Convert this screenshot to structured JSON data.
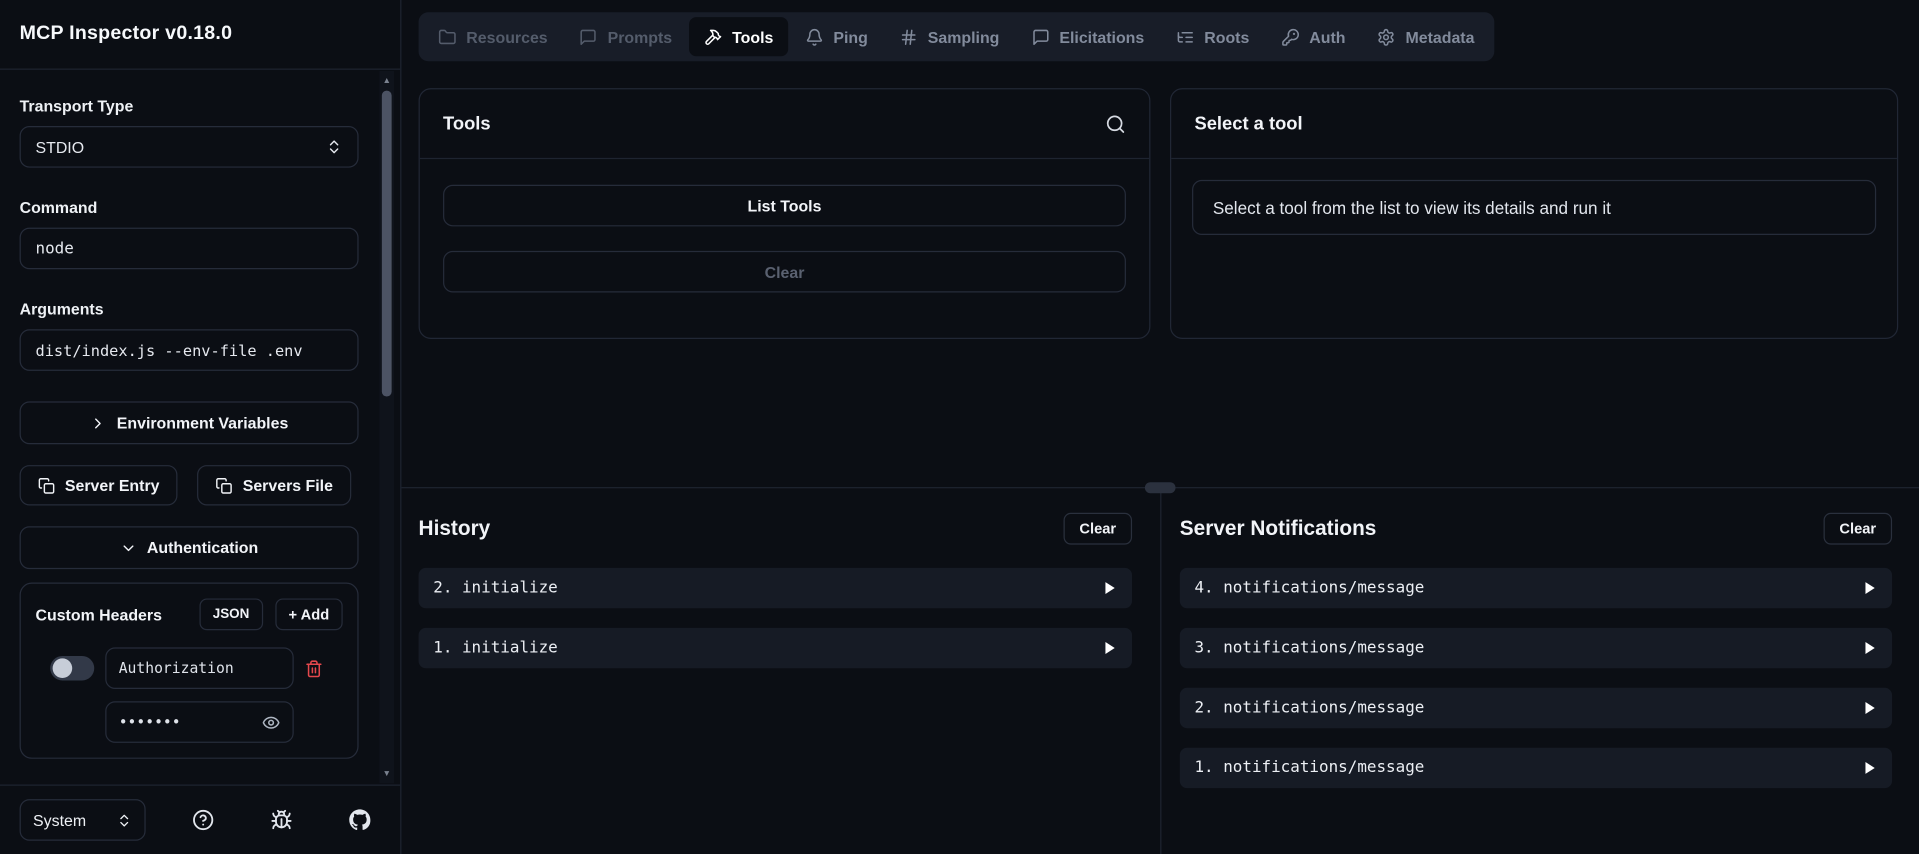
{
  "app": {
    "title": "MCP Inspector v0.18.0"
  },
  "sidebar": {
    "transport_label": "Transport Type",
    "transport_value": "STDIO",
    "command_label": "Command",
    "command_value": "node",
    "arguments_label": "Arguments",
    "arguments_value": "dist/index.js --env-file .env",
    "environment_variables_button": "Environment Variables",
    "server_entry_button": "Server Entry",
    "servers_file_button": "Servers File",
    "authentication_button": "Authentication",
    "custom_headers": {
      "label": "Custom Headers",
      "json_button": "JSON",
      "add_button": "+ Add",
      "header_name": "Authorization",
      "header_value_masked": "•••••••"
    },
    "footer": {
      "theme_value": "System"
    }
  },
  "tabbar": {
    "tabs": [
      {
        "label": "Resources",
        "state": "disabled"
      },
      {
        "label": "Prompts",
        "state": "disabled"
      },
      {
        "label": "Tools",
        "state": "active"
      },
      {
        "label": "Ping",
        "state": "enabled"
      },
      {
        "label": "Sampling",
        "state": "enabled"
      },
      {
        "label": "Elicitations",
        "state": "enabled"
      },
      {
        "label": "Roots",
        "state": "enabled"
      },
      {
        "label": "Auth",
        "state": "enabled"
      },
      {
        "label": "Metadata",
        "state": "enabled"
      }
    ]
  },
  "tools_panel": {
    "title": "Tools",
    "list_tools_button": "List Tools",
    "clear_button": "Clear"
  },
  "tool_details_panel": {
    "title": "Select a tool",
    "empty_message": "Select a tool from the list to view its details and run it"
  },
  "history_panel": {
    "title": "History",
    "clear_button": "Clear",
    "items": [
      {
        "label": "2. initialize"
      },
      {
        "label": "1. initialize"
      }
    ]
  },
  "notifications_panel": {
    "title": "Server Notifications",
    "clear_button": "Clear",
    "items": [
      {
        "label": "4. notifications/message"
      },
      {
        "label": "3. notifications/message"
      },
      {
        "label": "2. notifications/message"
      },
      {
        "label": "1. notifications/message"
      }
    ]
  },
  "colors": {
    "background": "#0b0e14",
    "border": "#222836",
    "row_background": "#161b25",
    "active_tab_background": "#0b0e14",
    "muted_text": "#828b9c",
    "disabled_text": "#545c6b",
    "danger": "#e5484d"
  },
  "icon_names": [
    "folder-icon",
    "message-square-icon",
    "hammer-icon",
    "bell-icon",
    "hash-icon",
    "list-tree-icon",
    "key-icon",
    "settings-icon",
    "search-icon",
    "chevrons-up-down-icon",
    "chevron-right-icon",
    "chevron-down-icon",
    "copy-icon",
    "trash-icon",
    "eye-icon",
    "help-circle-icon",
    "bug-icon",
    "github-icon",
    "play-icon"
  ]
}
